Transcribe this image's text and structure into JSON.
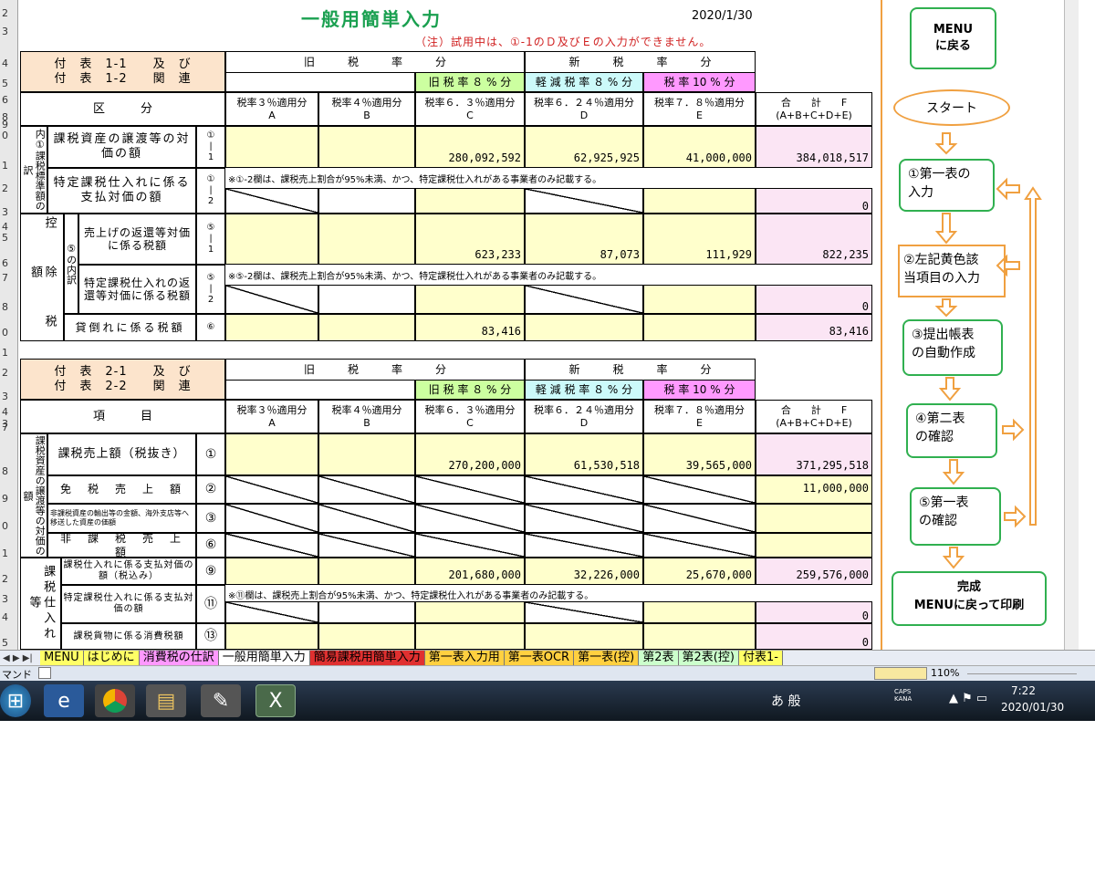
{
  "header": {
    "title": "一般用簡単入力",
    "date": "2020/1/30",
    "notice": "（注）試用中は、①-1のＤ及びＥの入力ができません。"
  },
  "rownums": [
    "2",
    "3",
    "4",
    "5",
    "6",
    "8",
    "9",
    "0",
    "1",
    "2",
    "3",
    "4",
    "5",
    "6",
    "7",
    "8",
    "0",
    "1",
    "2",
    "3",
    "4",
    "3",
    "7",
    "8",
    "9",
    "0",
    "1",
    "2",
    "3",
    "4",
    "5",
    "6"
  ],
  "t1": {
    "hdr_l1": "付　表　1-1　　及　び",
    "hdr_l2": "付　表　1-2　　関　連",
    "old_rate": "旧　　　税　　　率　　　分",
    "new_rate": "新　　　税　　　率　　　分",
    "col_c_band": "旧 税 率 ８ % 分",
    "col_d_band": "軽 減 税 率 ８ % 分",
    "col_e_band": "税 率 10 % 分",
    "kubun": "区　　　分",
    "cols": [
      {
        "t": "税率３％適用分",
        "l": "A"
      },
      {
        "t": "税率４％適用分",
        "l": "B"
      },
      {
        "t": "税率６．３％適用分",
        "l": "C"
      },
      {
        "t": "税率６．２４％適用分",
        "l": "D"
      },
      {
        "t": "税率７．８％適用分",
        "l": "E"
      }
    ],
    "total": "合　　計　　F",
    "total_sub": "(A+B+C+D+E)",
    "side1": "内①課税標準額の訳",
    "r1_label": "課税資産の譲渡等の対価の額",
    "r1_no": "①\n|\n1",
    "r1_vals": [
      "",
      "",
      "280,092,592",
      "62,925,925",
      "41,000,000",
      "384,018,517"
    ],
    "r2_label": "特定課税仕入れに係る支払対価の額",
    "r2_no": "①\n|\n2",
    "r2_note": "※①-2欄は、課税売上割合が95%未満、かつ、特定課税仕入れがある事業者のみ記載する。",
    "r2_total": "0",
    "side2": "控　除　税　額",
    "side2b": "⑤の内訳",
    "r3_label": "売上げの返還等対価に係る税額",
    "r3_no": "⑤\n|\n1",
    "r3_vals": [
      "",
      "",
      "623,233",
      "87,073",
      "111,929",
      "822,235"
    ],
    "r4_label": "特定課税仕入れの返還等対価に係る税額",
    "r4_no": "⑤\n|\n2",
    "r4_note": "※⑤-2欄は、課税売上割合が95%未満、かつ、特定課税仕入れがある事業者のみ記載する。",
    "r4_total": "0",
    "r5_label": "貸倒れに係る税額",
    "r5_no": "⑥",
    "r5_vals": [
      "",
      "",
      "83,416",
      "",
      "",
      "83,416"
    ]
  },
  "t2": {
    "hdr_l1": "付　表　2-1　　及　び",
    "hdr_l2": "付　表　2-2　　関　連",
    "kubun": "項　　　目",
    "side1": "課税資産の譲渡等の対価の額",
    "r1_label": "課税売上額（税抜き）",
    "r1_no": "①",
    "r1_vals": [
      "",
      "",
      "270,200,000",
      "61,530,518",
      "39,565,000",
      "371,295,518"
    ],
    "r2_label": "免　税　売　上　額",
    "r2_no": "②",
    "r2_total": "11,000,000",
    "r3_label": "非課税資産の輸出等の金額、海外支店等へ移送した資産の価額",
    "r3_no": "③",
    "r4_label": "非　課　税　売　上　額",
    "r4_no": "⑥",
    "side2": "課税仕入れ等",
    "r5_label": "課税仕入れに係る支払対価の額（税込み）",
    "r5_no": "⑨",
    "r5_vals": [
      "",
      "",
      "201,680,000",
      "32,226,000",
      "25,670,000",
      "259,576,000"
    ],
    "r6_label": "特定課税仕入れに係る支払対価の額",
    "r6_no": "⑪",
    "r6_note": "※⑪欄は、課税売上割合が95%未満、かつ、特定課税仕入れがある事業者のみ記載する。",
    "r6_total": "0",
    "r7_label": "課税貨物に係る消費税額",
    "r7_no": "⑬",
    "r7_total": "0"
  },
  "flow": {
    "menu_back": "MENU\nに戻る",
    "start": "スタート",
    "step1": "①第一表の\n入力",
    "step2": "②左記黄色該\n当項目の入力",
    "step3": "③提出帳表\nの自動作成",
    "step4": "④第二表\nの確認",
    "step5": "⑤第一表\nの確認",
    "done": "完成\nMENUに戻って印刷"
  },
  "tabs": [
    "MENU",
    "はじめに",
    "消費税の仕訳",
    "一般用簡単入力",
    "簡易課税用簡単入力",
    "第一表入力用",
    "第一表OCR",
    "第一表(控)",
    "第2表",
    "第2表(控)",
    "付表1-"
  ],
  "status": {
    "left": "マンド",
    "zoom": "110%"
  },
  "taskbar": {
    "ime": "あ 般",
    "caps": "CAPS\nKANA",
    "time": "7:22",
    "date": "2020/01/30"
  },
  "colors": {
    "flow_green": "#30b050",
    "flow_orange": "#f0a040"
  }
}
